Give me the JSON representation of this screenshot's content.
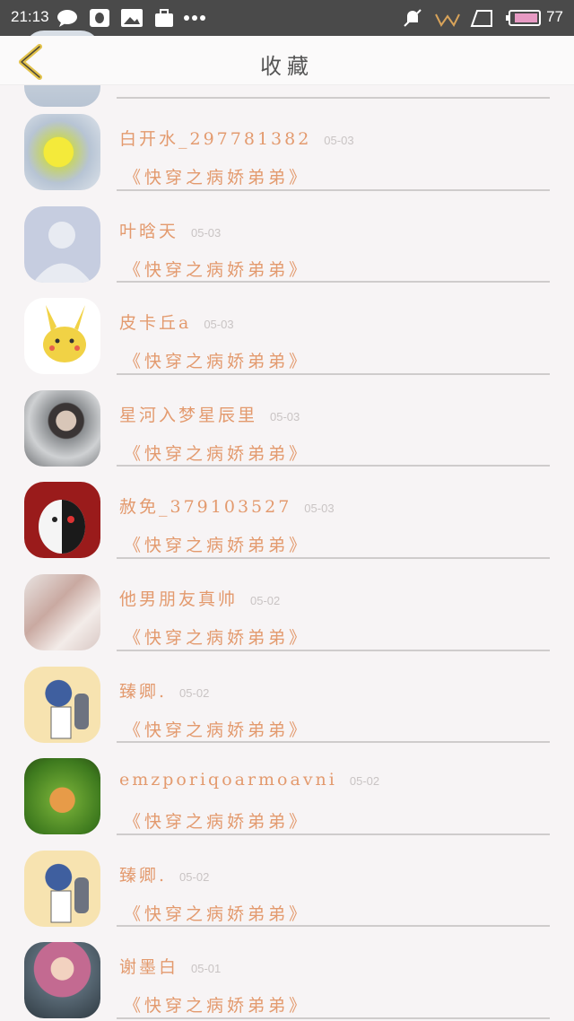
{
  "status_bar": {
    "time": "21:13",
    "battery": "77"
  },
  "header": {
    "title": "收藏"
  },
  "items": [
    {
      "name": "",
      "date": "",
      "book": ""
    },
    {
      "name": "白开水_297781382",
      "date": "05-03",
      "book": "《快穿之病娇弟弟》"
    },
    {
      "name": "叶晗天",
      "date": "05-03",
      "book": "《快穿之病娇弟弟》"
    },
    {
      "name": "皮卡丘a",
      "date": "05-03",
      "book": "《快穿之病娇弟弟》"
    },
    {
      "name": "星河入梦星辰里",
      "date": "05-03",
      "book": "《快穿之病娇弟弟》"
    },
    {
      "name": "赦免_379103527",
      "date": "05-03",
      "book": "《快穿之病娇弟弟》"
    },
    {
      "name": "他男朋友真帅",
      "date": "05-02",
      "book": "《快穿之病娇弟弟》"
    },
    {
      "name": "臻卿.",
      "date": "05-02",
      "book": "《快穿之病娇弟弟》"
    },
    {
      "name": "emzporiqoarmoavni",
      "date": "05-02",
      "book": "《快穿之病娇弟弟》"
    },
    {
      "name": "臻卿.",
      "date": "05-02",
      "book": "《快穿之病娇弟弟》"
    },
    {
      "name": "谢墨白",
      "date": "05-01",
      "book": "《快穿之病娇弟弟》"
    }
  ]
}
